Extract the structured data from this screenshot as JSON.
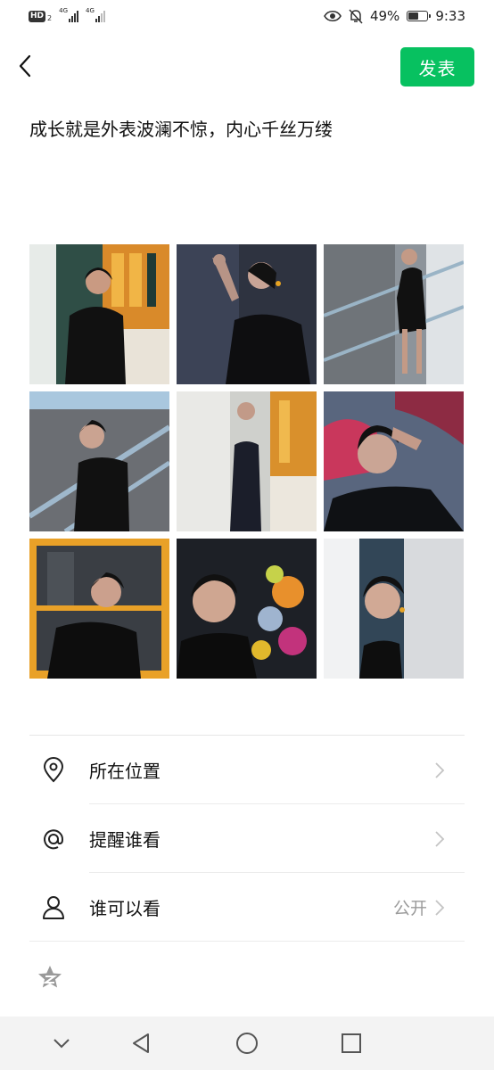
{
  "status_bar": {
    "hd_label": "HD",
    "hd_sub": "2",
    "network_1": "4G",
    "network_2": "4G",
    "battery_percent": "49%",
    "battery_level": 0.49,
    "time": "9:33"
  },
  "header": {
    "publish_label": "发表"
  },
  "post": {
    "text": "成长就是外表波澜不惊，内心千丝万缕"
  },
  "photos": {
    "count": 9
  },
  "options": {
    "location_label": "所在位置",
    "mention_label": "提醒谁看",
    "visibility_label": "谁可以看",
    "visibility_value": "公开"
  },
  "colors": {
    "accent": "#07c160",
    "text_primary": "#111111",
    "text_secondary": "#9b9b9b",
    "nav_background": "#f3f3f3"
  },
  "icons": {
    "back": "chevron-left-icon",
    "location": "location-pin-icon",
    "mention": "at-icon",
    "visibility": "person-icon",
    "star": "star-icon"
  }
}
